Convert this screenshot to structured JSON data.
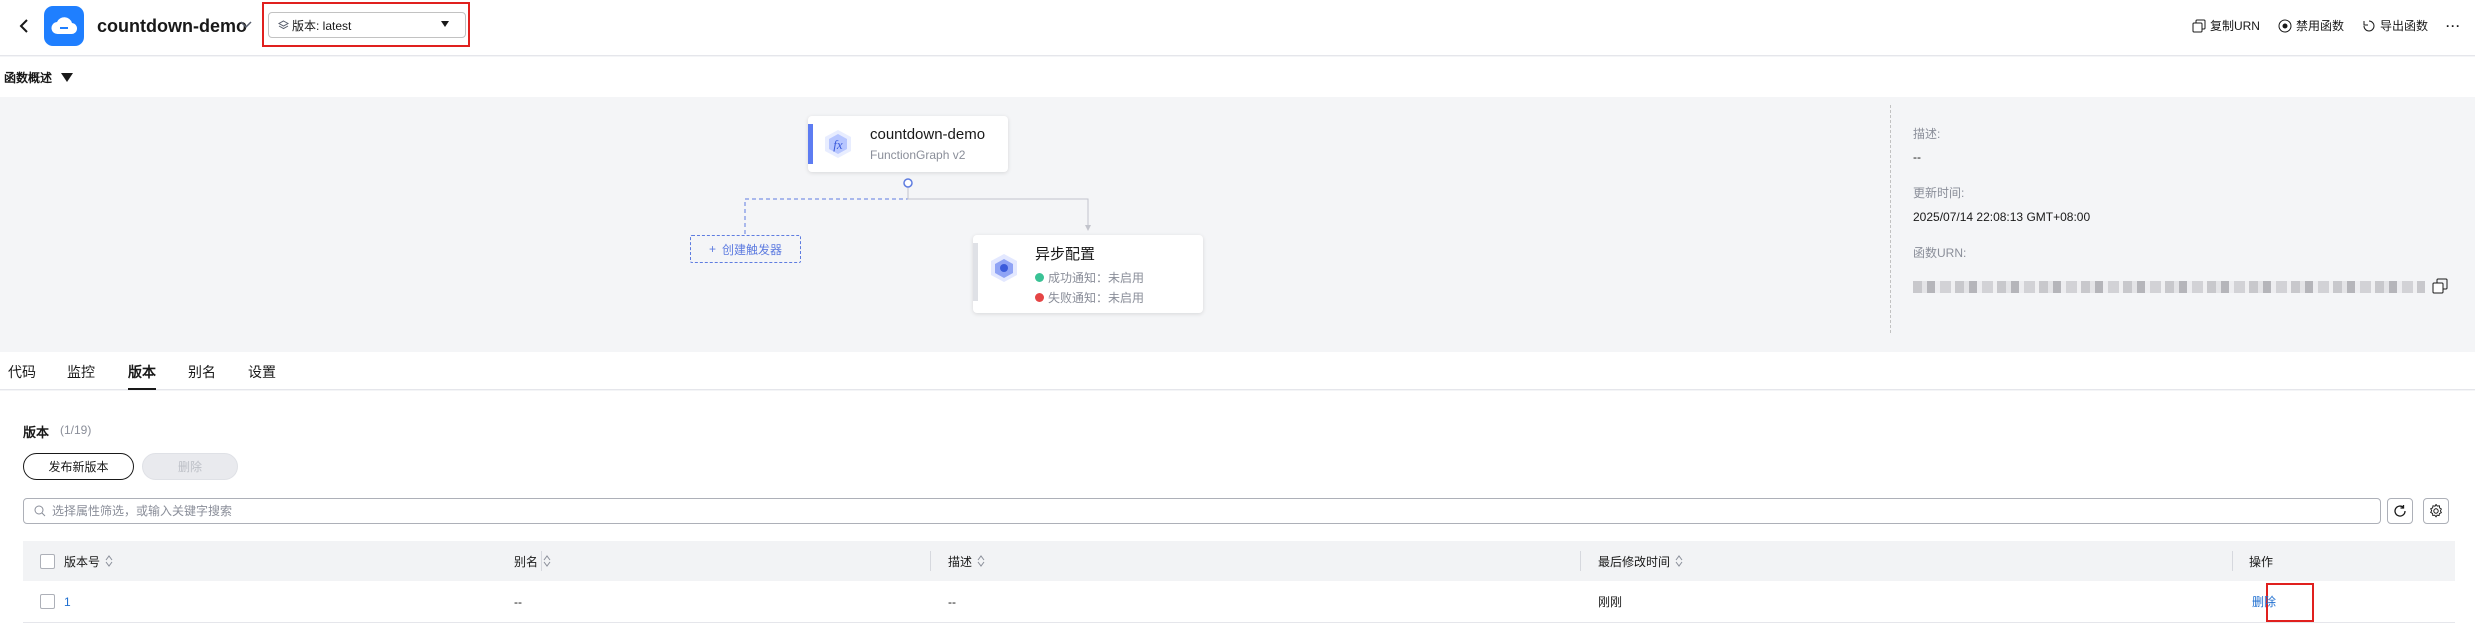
{
  "header": {
    "function_name": "countdown-demo",
    "version_select": "版本: latest",
    "actions": [
      {
        "label": "复制URN",
        "icon": "copy-icon"
      },
      {
        "label": "禁用函数",
        "icon": "disable-icon"
      },
      {
        "label": "导出函数",
        "icon": "export-icon"
      }
    ],
    "more": "···"
  },
  "overview": {
    "label": "函数概述",
    "function_node": {
      "name": "countdown-demo",
      "runtime": "FunctionGraph v2"
    },
    "trigger_button": "创建触发器",
    "async_node": {
      "title": "异步配置",
      "success": "成功通知：未启用",
      "failure": "失败通知：未启用"
    },
    "details": {
      "desc_label": "描述:",
      "desc_value": "--",
      "updated_label": "更新时间:",
      "updated_value": "2025/07/14 22:08:13 GMT+08:00",
      "urn_label": "函数URN:"
    }
  },
  "tabs": [
    "代码",
    "监控",
    "版本",
    "别名",
    "设置"
  ],
  "active_tab": "版本",
  "versions": {
    "title": "版本",
    "count": "(1/19)",
    "publish_button": "发布新版本",
    "delete_button": "删除",
    "search_placeholder": "选择属性筛选，或输入关键字搜索",
    "columns": [
      "版本号",
      "别名",
      "描述",
      "最后修改时间",
      "操作"
    ],
    "rows": [
      {
        "version": "1",
        "alias": "--",
        "desc": "--",
        "modified": "刚刚",
        "action": "删除"
      }
    ]
  },
  "colors": {
    "accent": "#5e7ce0",
    "link": "#1f6fd0",
    "highlight": "#e0201e",
    "success": "#3ac295",
    "failure": "#e54545"
  }
}
